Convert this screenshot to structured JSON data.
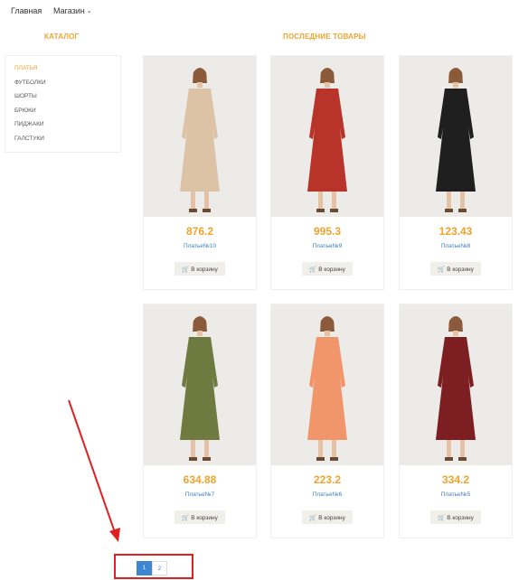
{
  "nav": {
    "home": "Главная",
    "shop": "Магазин"
  },
  "catalog": {
    "title": "КАТАЛОГ",
    "items": [
      "ПЛАТЬЯ",
      "ФУТБОЛКИ",
      "ШОРТЫ",
      "БРЮКИ",
      "ПИДЖАКИ",
      "ГАЛСТУКИ"
    ],
    "active_index": 0
  },
  "latest": {
    "title": "ПОСЛЕДНИЕ ТОВАРЫ"
  },
  "products": [
    {
      "price": "876.2",
      "name": "Платье№10",
      "cart": "В корзину",
      "dress_color": "#dcc3a6"
    },
    {
      "price": "995.3",
      "name": "Платье№9",
      "cart": "В корзину",
      "dress_color": "#b8332a"
    },
    {
      "price": "123.43",
      "name": "Платье№8",
      "cart": "В корзину",
      "dress_color": "#1f1f1f"
    },
    {
      "price": "634.88",
      "name": "Платье№7",
      "cart": "В корзину",
      "dress_color": "#6e7a3f"
    },
    {
      "price": "223.2",
      "name": "Платье№6",
      "cart": "В корзину",
      "dress_color": "#f1956b"
    },
    {
      "price": "334.2",
      "name": "Платье№5",
      "cart": "В корзину",
      "dress_color": "#7d1f22"
    }
  ],
  "pagination": {
    "pages": [
      "1",
      "2"
    ],
    "current": "1"
  },
  "colors": {
    "accent": "#F0A32B",
    "link": "#3a7fc4",
    "annotation": "#e02020"
  }
}
